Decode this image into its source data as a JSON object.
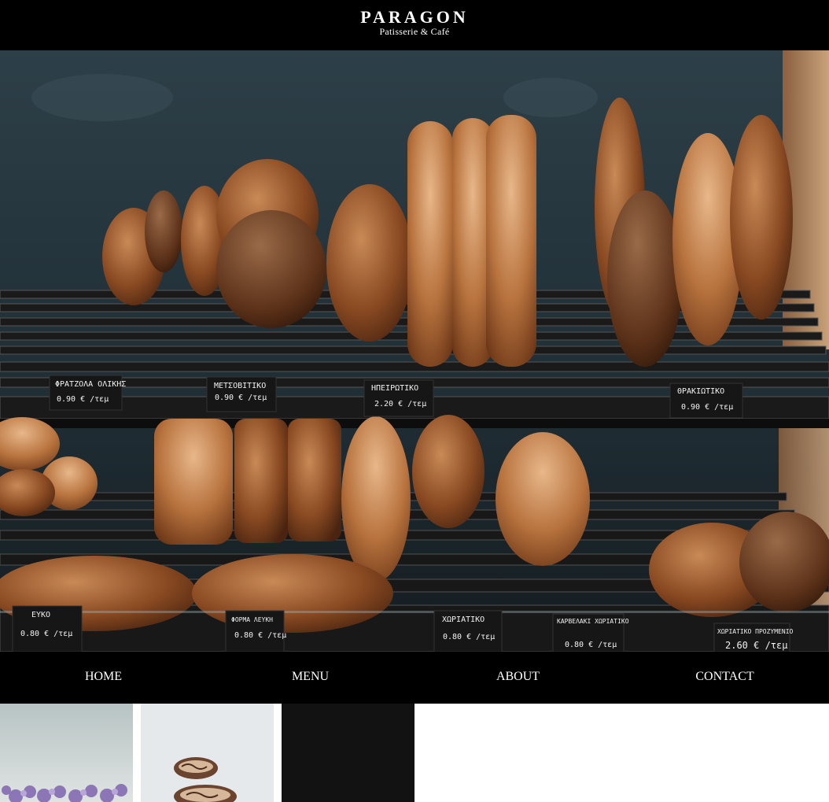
{
  "brand": {
    "title": "PARAGON",
    "subtitle": "Patisserie & Café"
  },
  "hero": {
    "price_labels": [
      {
        "name": "ΦΡΑΤΖΟΛΑ ΟΛΙΚΗΣ",
        "price": "0.90 € /τεμ"
      },
      {
        "name": "ΜΕΤΣΟΒΙΤΙΚΟ",
        "price": "0.90 € /τεμ"
      },
      {
        "name": "ΗΠΕΙΡΩΤΙΚΟ",
        "price": "2.20 € /τεμ"
      },
      {
        "name": "ΘΡΑΚΙΩΤΙΚΟ",
        "price": "0.90 € /τεμ"
      },
      {
        "name": "ΕΥΚΟ",
        "price": "0.80 € /τεμ"
      },
      {
        "name": "ΦΟΡΜΑ ΛΕΥΚΗ",
        "price": "0.80 € /τεμ"
      },
      {
        "name": "ΧΩΡΙΑΤΙΚΟ",
        "price": "0.80 € /τεμ"
      },
      {
        "name": "ΚΑΡΒΕΛΑΚΙ ΧΩΡΙΑΤΙΚΟ",
        "price": "0.80 € /τεμ"
      },
      {
        "name": "ΧΩΡΙΑΤΙΚΟ ΠΡΟΖΥΜΕΝΙΟ",
        "price": "2.60 € /τεμ"
      }
    ]
  },
  "nav": {
    "items": [
      "HOME",
      "MENU",
      "ABOUT",
      "CONTACT"
    ]
  },
  "colors": {
    "header_bg": "#000000",
    "nav_bg": "#000000",
    "text": "#ffffff",
    "wall": "#24343c",
    "crust": "#8a4a22",
    "shelf": "#2a2a2a"
  }
}
